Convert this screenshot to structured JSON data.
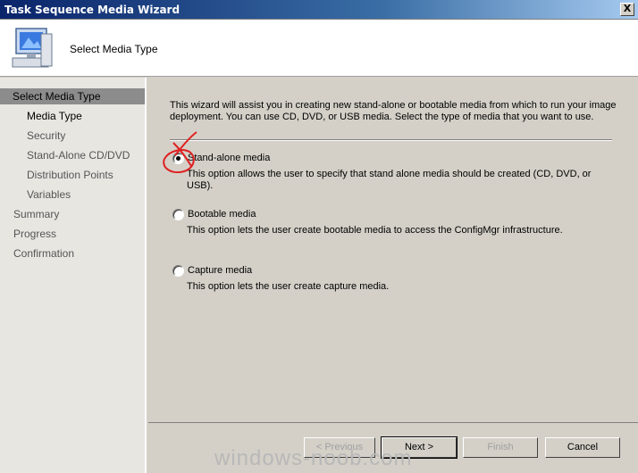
{
  "window": {
    "title": "Task Sequence Media Wizard",
    "close_glyph": "X"
  },
  "header": {
    "title": "Select Media Type",
    "icon": "computer-icon"
  },
  "sidebar": {
    "items": [
      {
        "label": "Select Media Type"
      },
      {
        "label": "Media Type"
      },
      {
        "label": "Security"
      },
      {
        "label": "Stand-Alone CD/DVD"
      },
      {
        "label": "Distribution Points"
      },
      {
        "label": "Variables"
      },
      {
        "label": "Summary"
      },
      {
        "label": "Progress"
      },
      {
        "label": "Confirmation"
      }
    ]
  },
  "content": {
    "intro": "This wizard will assist you in creating new stand-alone or bootable media from which to run your image deployment. You can use CD, DVD, or USB media. Select the type of media that you want to use.",
    "options": [
      {
        "label": "Stand-alone media",
        "description": "This option allows the user to specify that stand alone media should be created (CD, DVD, or USB).",
        "selected": true
      },
      {
        "label": "Bootable media",
        "description": "This option lets the user create bootable media to access the ConfigMgr infrastructure.",
        "selected": false
      },
      {
        "label": "Capture media",
        "description": "This option lets the user create capture media.",
        "selected": false
      }
    ]
  },
  "buttons": {
    "previous": "< Previous",
    "next": "Next >",
    "finish": "Finish",
    "cancel": "Cancel"
  },
  "watermark": "windows-noob.com",
  "colors": {
    "titlebar_start": "#0a246a",
    "titlebar_end": "#a6caf0",
    "annotation": "#e02020"
  }
}
